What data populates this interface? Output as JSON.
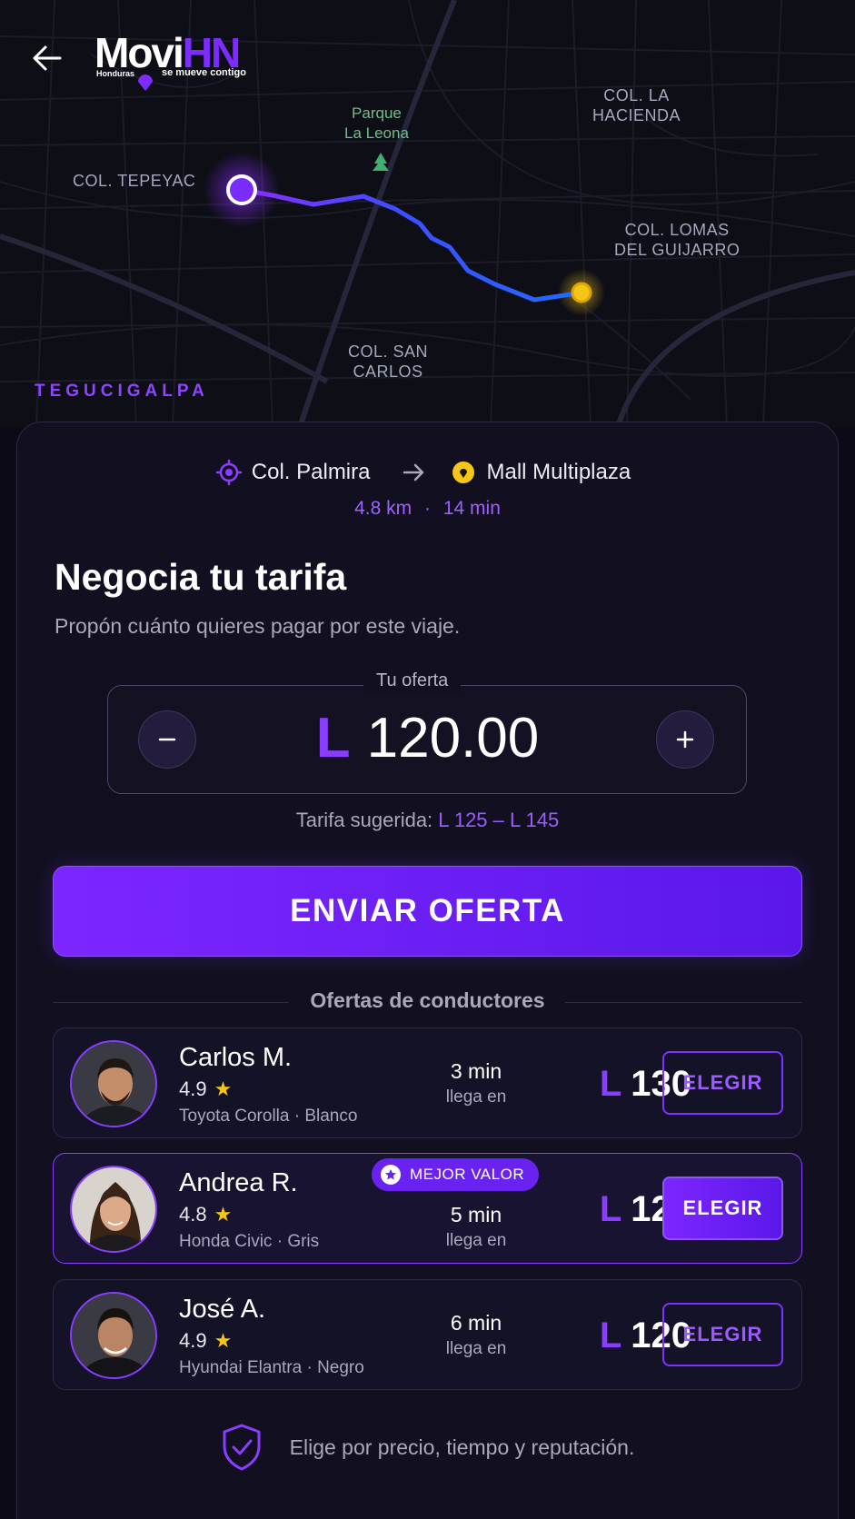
{
  "brand": {
    "name_main": "Movi",
    "name_accent": "HN",
    "country": "Honduras",
    "tagline": "se mueve contigo"
  },
  "map": {
    "labels": {
      "tepeyac": "COL. TEPEYAC",
      "park_line1": "Parque",
      "park_line2": "La Leona",
      "hacienda_line1": "COL. LA",
      "hacienda_line2": "HACIENDA",
      "lomas_line1": "COL. LOMAS",
      "lomas_line2": "DEL GUIJARRO",
      "sancarlos_line1": "COL. SAN",
      "sancarlos_line2": "CARLOS",
      "city": "TEGUCIGALPA"
    },
    "route_colors": {
      "start": "#8b2cff",
      "end": "#1f6bff",
      "destination": "#f5c518"
    }
  },
  "trip": {
    "origin": "Col. Palmira",
    "destination": "Mall Multiplaza",
    "distance": "4.8 km",
    "separator": "·",
    "duration": "14 min"
  },
  "negotiate": {
    "title": "Negocia tu tarifa",
    "subtitle": "Propón cuánto quieres pagar por este viaje.",
    "offer_label": "Tu oferta",
    "currency": "L",
    "offer_value": "120.00",
    "decrement_icon": "minus-icon",
    "increment_icon": "plus-icon",
    "suggested_label": "Tarifa sugerida:",
    "suggested_range": "L 125 – L 145",
    "send_label": "ENVIAR OFERTA"
  },
  "offers": {
    "section_title": "Ofertas de conductores",
    "eta_sub": "llega en",
    "choose_label": "ELEGIR",
    "badge_label": "MEJOR VALOR",
    "drivers": [
      {
        "name": "Carlos M.",
        "rating": "4.9",
        "car": "Toyota Corolla · Blanco",
        "eta": "3 min",
        "currency": "L",
        "price": "130"
      },
      {
        "name": "Andrea R.",
        "rating": "4.8",
        "car": "Honda Civic · Gris",
        "eta": "5 min",
        "currency": "L",
        "price": "125"
      },
      {
        "name": "José A.",
        "rating": "4.9",
        "car": "Hyundai Elantra · Negro",
        "eta": "6 min",
        "currency": "L",
        "price": "120"
      }
    ]
  },
  "footer": {
    "text": "Elige por precio, tiempo y reputación."
  },
  "colors": {
    "accent": "#8a3dff",
    "background": "#0b0a16",
    "card": "#121020",
    "star": "#f5c518"
  }
}
